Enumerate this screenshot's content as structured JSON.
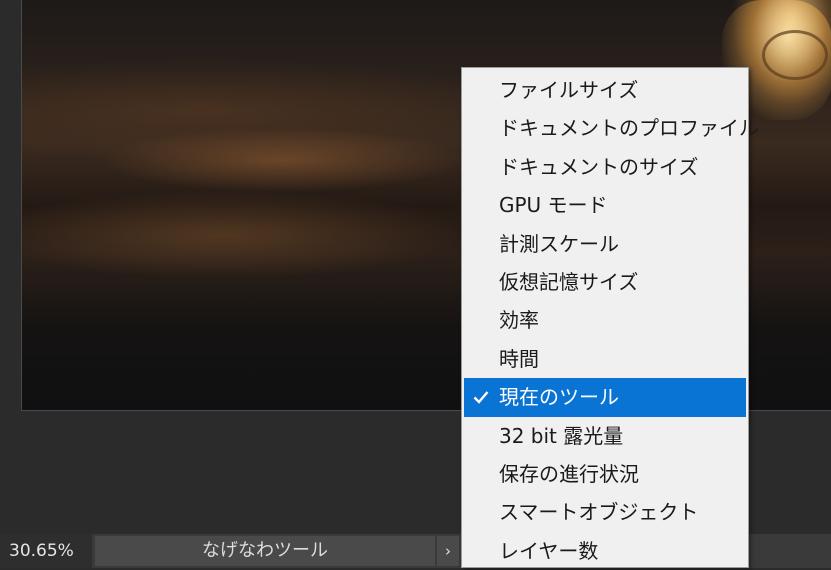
{
  "status_bar": {
    "zoom": "30.65%",
    "info": "なげなわツール",
    "chevron": "›"
  },
  "menu": {
    "items": [
      {
        "label": "ファイルサイズ",
        "checked": false
      },
      {
        "label": "ドキュメントのプロファイル",
        "checked": false
      },
      {
        "label": "ドキュメントのサイズ",
        "checked": false
      },
      {
        "label": "GPU モード",
        "checked": false
      },
      {
        "label": "計測スケール",
        "checked": false
      },
      {
        "label": "仮想記憶サイズ",
        "checked": false
      },
      {
        "label": "効率",
        "checked": false
      },
      {
        "label": "時間",
        "checked": false
      },
      {
        "label": "現在のツール",
        "checked": true
      },
      {
        "label": "32 bit 露光量",
        "checked": false
      },
      {
        "label": "保存の進行状況",
        "checked": false
      },
      {
        "label": "スマートオブジェクト",
        "checked": false
      },
      {
        "label": "レイヤー数",
        "checked": false
      }
    ],
    "selection_color": "#0a74d4"
  }
}
